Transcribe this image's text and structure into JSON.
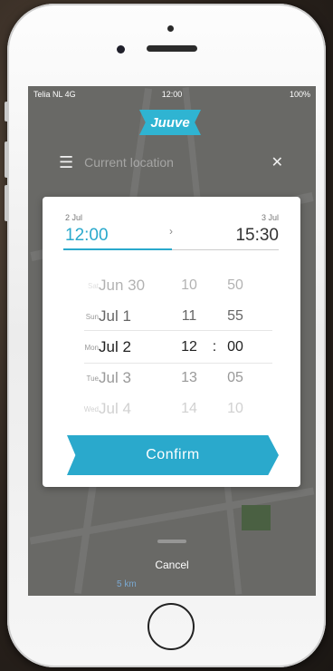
{
  "status_bar": {
    "carrier": "Telia NL 4G",
    "time": "12:00",
    "battery": "100%"
  },
  "app": {
    "logo": "Juuve"
  },
  "search": {
    "placeholder": "Current location"
  },
  "map": {
    "scale": "5 km"
  },
  "range": {
    "from_date": "2 Jul",
    "from_time": "12:00",
    "to_date": "3 Jul",
    "to_time": "15:30"
  },
  "picker": {
    "rows": [
      {
        "weekday": "Sat",
        "date": "Jun 30",
        "hour": "10",
        "minute": "50"
      },
      {
        "weekday": "Sun",
        "date": "Jul 1",
        "hour": "11",
        "minute": "55"
      },
      {
        "weekday": "Mon",
        "date": "Jul 2",
        "hour": "12",
        "separator": ":",
        "minute": "00"
      },
      {
        "weekday": "Tue",
        "date": "Jul 3",
        "hour": "13",
        "minute": "05"
      },
      {
        "weekday": "Wed",
        "date": "Jul 4",
        "hour": "14",
        "minute": "10"
      }
    ]
  },
  "confirm_label": "Confirm",
  "cancel_label": "Cancel",
  "colors": {
    "accent": "#2aa9cc",
    "dim_overlay": "rgba(0,0,0,0.52)"
  }
}
